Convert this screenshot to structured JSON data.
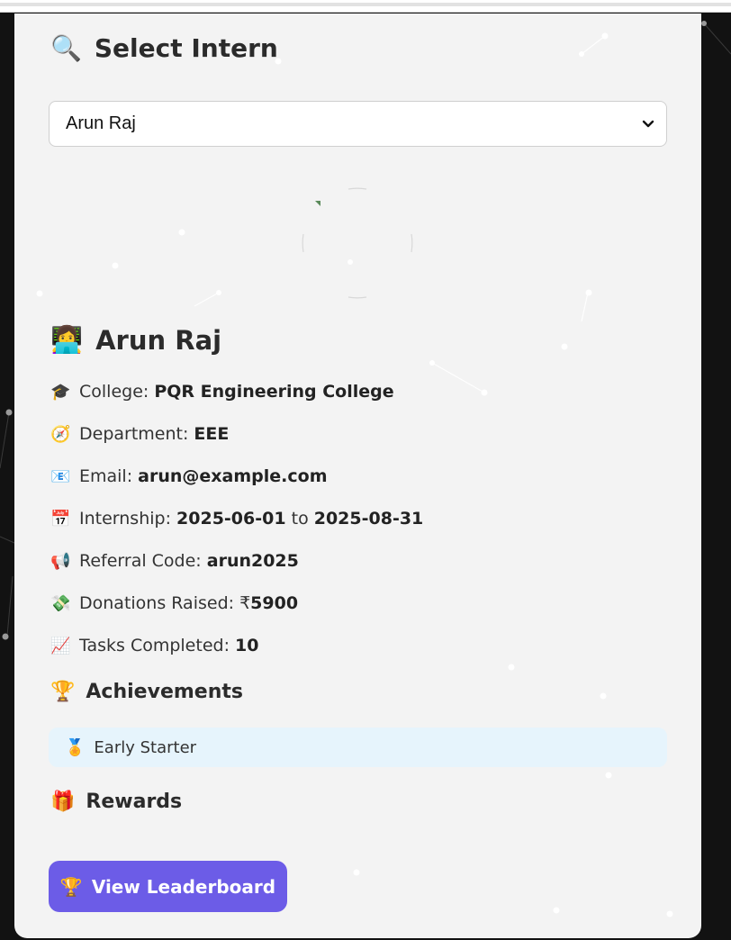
{
  "select_section": {
    "icon": "magnifier-icon",
    "title": "Select Intern",
    "selected": "Arun Raj",
    "options": [
      "Arun Raj"
    ]
  },
  "profile": {
    "name_icon": "person-at-laptop-icon",
    "name": "Arun Raj",
    "fields": [
      {
        "icon": "graduation-cap-icon",
        "label": "College: ",
        "value": "PQR Engineering College"
      },
      {
        "icon": "compass-icon",
        "label": "Department: ",
        "value": "EEE"
      },
      {
        "icon": "email-icon",
        "label": "Email: ",
        "value": "arun@example.com"
      },
      {
        "icon": "calendar-icon",
        "label": "Internship: ",
        "value": "2025-06-01",
        "mid": " to ",
        "value2": "2025-08-31"
      },
      {
        "icon": "megaphone-icon",
        "label": "Referral Code: ",
        "value": "arun2025"
      },
      {
        "icon": "money-icon",
        "label": "Donations Raised: ₹",
        "value": "5900"
      },
      {
        "icon": "chart-icon",
        "label": "Tasks Completed: ",
        "value": "10"
      }
    ]
  },
  "achievements": {
    "icon": "trophy-icon",
    "title": "Achievements",
    "items": [
      {
        "icon": "medal-icon",
        "label": "Early Starter"
      }
    ]
  },
  "rewards": {
    "icon": "gift-icon",
    "title": "Rewards"
  },
  "leaderboard_button": {
    "icon": "trophy-icon",
    "label": "View Leaderboard"
  },
  "colors": {
    "page_bg": "#121212",
    "card_bg": "#f3f3f3",
    "accent": "#6c5ce7",
    "badge_bg": "#e6f4fc"
  }
}
